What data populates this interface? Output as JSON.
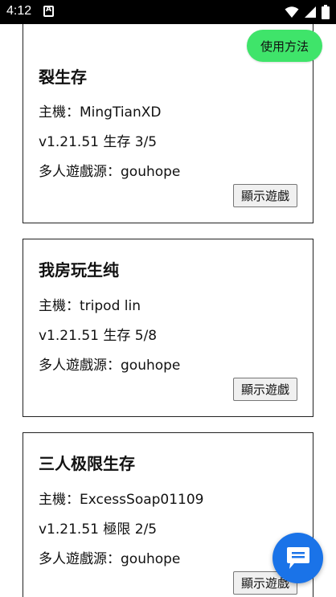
{
  "status_bar": {
    "time": "4:12"
  },
  "header": {
    "help_label": "使用方法"
  },
  "cards": [
    {
      "title": "裂生存",
      "host": "主機：MingTianXD",
      "version": "v1.21.51 生存 3/5",
      "source": "多人遊戲源：gouhope",
      "button": "顯示遊戲"
    },
    {
      "title": "我房玩生纯",
      "host": "主機：tripod lin",
      "version": "v1.21.51 生存 5/8",
      "source": "多人遊戲源：gouhope",
      "button": "顯示遊戲"
    },
    {
      "title": "三人极限生存",
      "host": "主機：ExcessSoap01109",
      "version": "v1.21.51 極限 2/5",
      "source": "多人遊戲源：gouhope",
      "button": "顯示遊戲"
    }
  ],
  "colors": {
    "help_button": "#3fe46a",
    "chat_button": "#1a73e8"
  },
  "icons": {
    "chat": "chat-icon",
    "wifi": "wifi-icon",
    "signal": "signal-icon",
    "battery": "battery-icon"
  }
}
